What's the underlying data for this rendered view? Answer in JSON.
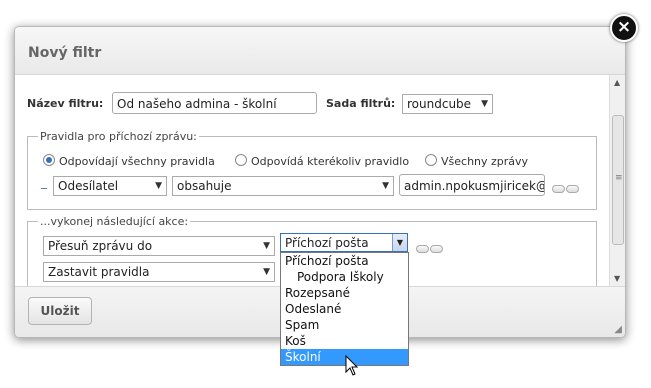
{
  "dialog": {
    "title": "Nový filtr",
    "close_glyph": "×"
  },
  "filter": {
    "name_label": "Název filtru:",
    "name_value": "Od našeho admina - školní",
    "set_label": "Sada filtrů:",
    "set_value": "roundcube"
  },
  "rules": {
    "legend": "Pravidla pro příchozí zprávu:",
    "radio_all": "Odpovídají všechny pravidla",
    "radio_any": "Odpovídá kterékoliv pravidlo",
    "radio_every": "Všechny zprávy",
    "selected_radio": "radio_all",
    "rule_prefix": "_",
    "header_value": "Odesílatel",
    "operator_value": "obsahuje",
    "target_value": "admin.npokusmjiricek@"
  },
  "actions": {
    "legend": "...vykonej následující akce:",
    "action1_value": "Přesuň zprávu do",
    "folder_value": "Příchozí pošta",
    "action2_value": "Zastavit pravidla",
    "folder_options": [
      "Příchozí pošta",
      "Podpora lškoly",
      "Rozepsané",
      "Odeslané",
      "Spam",
      "Koš",
      "Školní"
    ],
    "highlighted_option": "Školní"
  },
  "footer": {
    "save_label": "Uložit"
  },
  "icons": {
    "dropdown_arrow": "▼",
    "scroll_up": "▲",
    "scroll_down": "▼"
  },
  "colors": {
    "selected_option_bg": "#3399ff",
    "radio_selected": "#3a6fb7"
  }
}
